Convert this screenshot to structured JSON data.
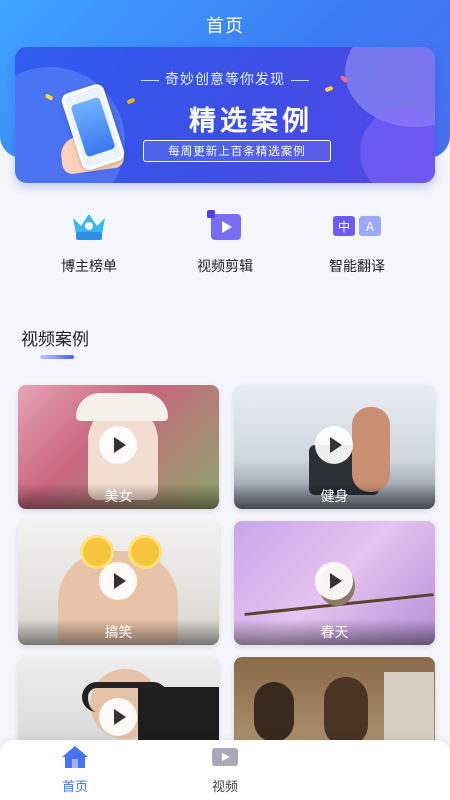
{
  "header": {
    "title": "首页"
  },
  "banner": {
    "subtitle": "奇妙创意等你发现",
    "title": "精选案例",
    "pill": "每周更新上百条精选案例"
  },
  "quick_actions": [
    {
      "label": "博主榜单",
      "icon": "crown-icon"
    },
    {
      "label": "视频剪辑",
      "icon": "video-edit-icon"
    },
    {
      "label": "智能翻译",
      "icon": "translate-icon"
    }
  ],
  "section": {
    "title": "视频案例"
  },
  "videos": [
    {
      "caption": "美女"
    },
    {
      "caption": "健身"
    },
    {
      "caption": "搞笑"
    },
    {
      "caption": "春天"
    },
    {
      "caption": ""
    },
    {
      "caption": ""
    }
  ],
  "tabbar": {
    "items": [
      {
        "label": "首页",
        "icon": "home-icon",
        "active": true
      },
      {
        "label": "视频",
        "icon": "video-icon",
        "active": false
      }
    ]
  },
  "colors": {
    "primary": "#3b7bf5",
    "accent": "#5a45e8"
  }
}
